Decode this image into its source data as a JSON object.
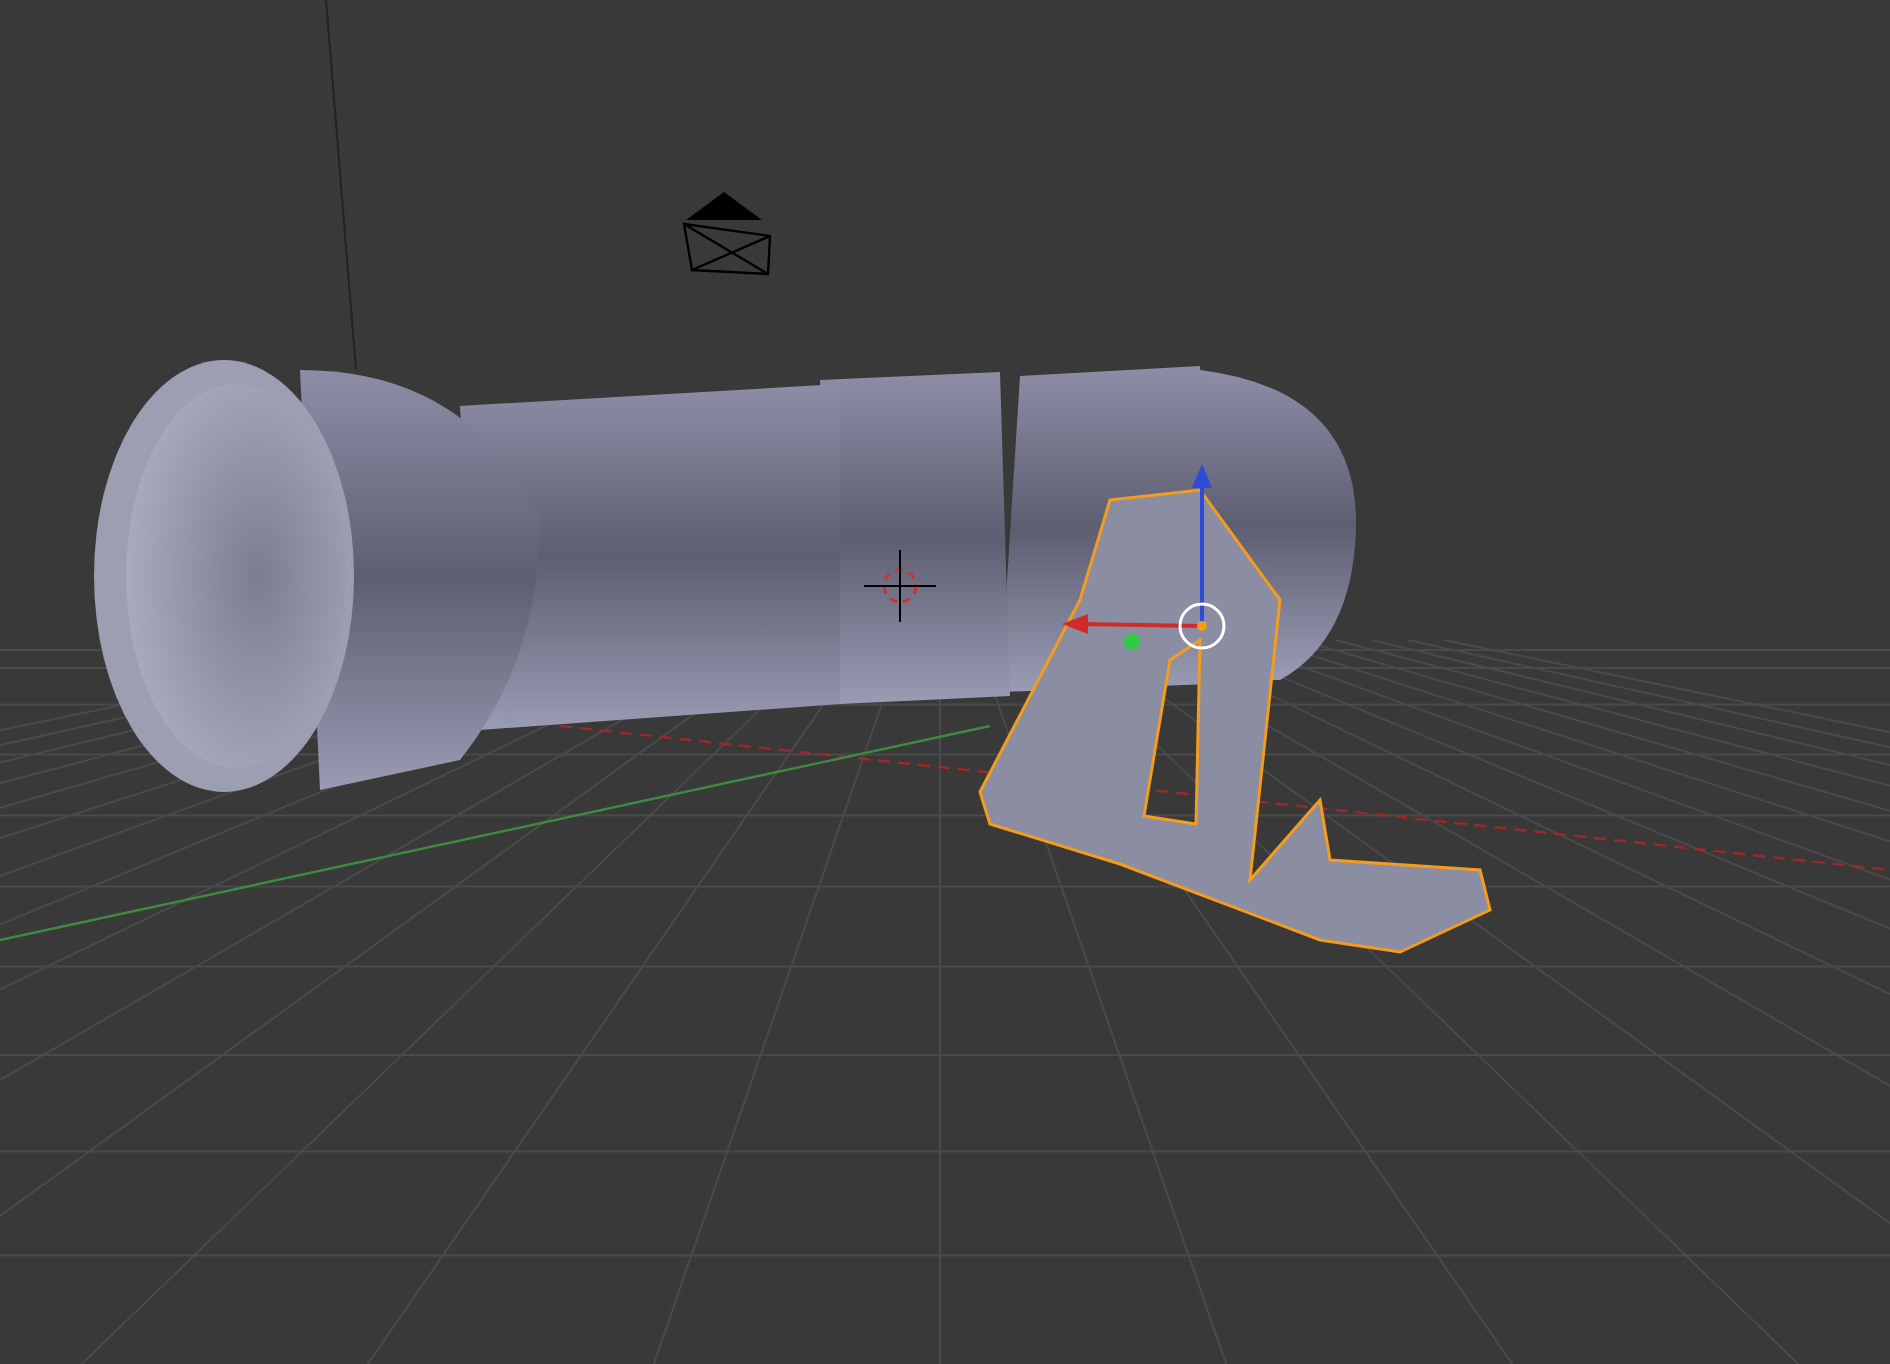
{
  "objects": [
    {
      "kind": "cannon",
      "selected": false
    },
    {
      "kind": "bracket",
      "selected": true
    },
    {
      "kind": "camera",
      "selected": false
    }
  ]
}
